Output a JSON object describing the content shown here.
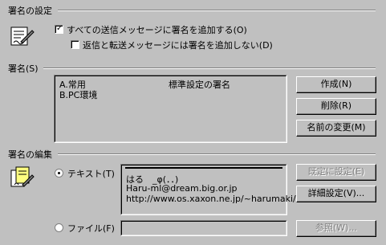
{
  "sections": {
    "settings_title": "署名の設定",
    "signature_title": "署名(S)",
    "edit_title": "署名の編集"
  },
  "options": {
    "add_all_label": "すべての送信メッセージに署名を追加する(O)",
    "add_all_checked": true,
    "no_reply_label": "返信と転送メッセージには署名を追加しない(D)",
    "no_reply_checked": false
  },
  "signature_list": {
    "items": [
      {
        "name": "A.常用",
        "default_note": "標準設定の署名"
      },
      {
        "name": "B.PC環境",
        "default_note": ""
      }
    ]
  },
  "buttons": {
    "create": "作成(N)",
    "delete": "削除(R)",
    "rename": "名前の変更(M)",
    "set_default": "既定に設定(E)",
    "advanced": "詳細設定(V)...",
    "browse": "参照(W)..."
  },
  "edit": {
    "text_radio_label": "テキスト(T)",
    "text_selected": true,
    "file_radio_label": "ファイル(F)",
    "file_selected": false,
    "text_lines": [
      "はる　_φ(．．)",
      "Haru-ml@dream.big.or.jp",
      "http://www.os.xaxon.ne.jp/~harumaki/"
    ],
    "file_path": ""
  }
}
